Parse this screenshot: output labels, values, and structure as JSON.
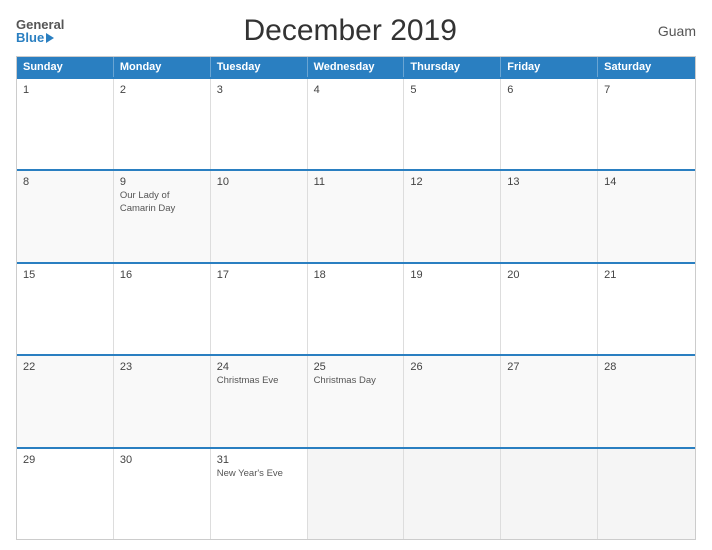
{
  "header": {
    "title": "December 2019",
    "country": "Guam",
    "logo": {
      "general": "General",
      "blue": "Blue"
    }
  },
  "days": [
    "Sunday",
    "Monday",
    "Tuesday",
    "Wednesday",
    "Thursday",
    "Friday",
    "Saturday"
  ],
  "weeks": [
    [
      {
        "date": "1",
        "event": ""
      },
      {
        "date": "2",
        "event": ""
      },
      {
        "date": "3",
        "event": ""
      },
      {
        "date": "4",
        "event": ""
      },
      {
        "date": "5",
        "event": ""
      },
      {
        "date": "6",
        "event": ""
      },
      {
        "date": "7",
        "event": ""
      }
    ],
    [
      {
        "date": "8",
        "event": ""
      },
      {
        "date": "9",
        "event": "Our Lady of Camarin Day"
      },
      {
        "date": "10",
        "event": ""
      },
      {
        "date": "11",
        "event": ""
      },
      {
        "date": "12",
        "event": ""
      },
      {
        "date": "13",
        "event": ""
      },
      {
        "date": "14",
        "event": ""
      }
    ],
    [
      {
        "date": "15",
        "event": ""
      },
      {
        "date": "16",
        "event": ""
      },
      {
        "date": "17",
        "event": ""
      },
      {
        "date": "18",
        "event": ""
      },
      {
        "date": "19",
        "event": ""
      },
      {
        "date": "20",
        "event": ""
      },
      {
        "date": "21",
        "event": ""
      }
    ],
    [
      {
        "date": "22",
        "event": ""
      },
      {
        "date": "23",
        "event": ""
      },
      {
        "date": "24",
        "event": "Christmas Eve"
      },
      {
        "date": "25",
        "event": "Christmas Day"
      },
      {
        "date": "26",
        "event": ""
      },
      {
        "date": "27",
        "event": ""
      },
      {
        "date": "28",
        "event": ""
      }
    ],
    [
      {
        "date": "29",
        "event": ""
      },
      {
        "date": "30",
        "event": ""
      },
      {
        "date": "31",
        "event": "New Year's Eve"
      },
      {
        "date": "",
        "event": ""
      },
      {
        "date": "",
        "event": ""
      },
      {
        "date": "",
        "event": ""
      },
      {
        "date": "",
        "event": ""
      }
    ]
  ]
}
